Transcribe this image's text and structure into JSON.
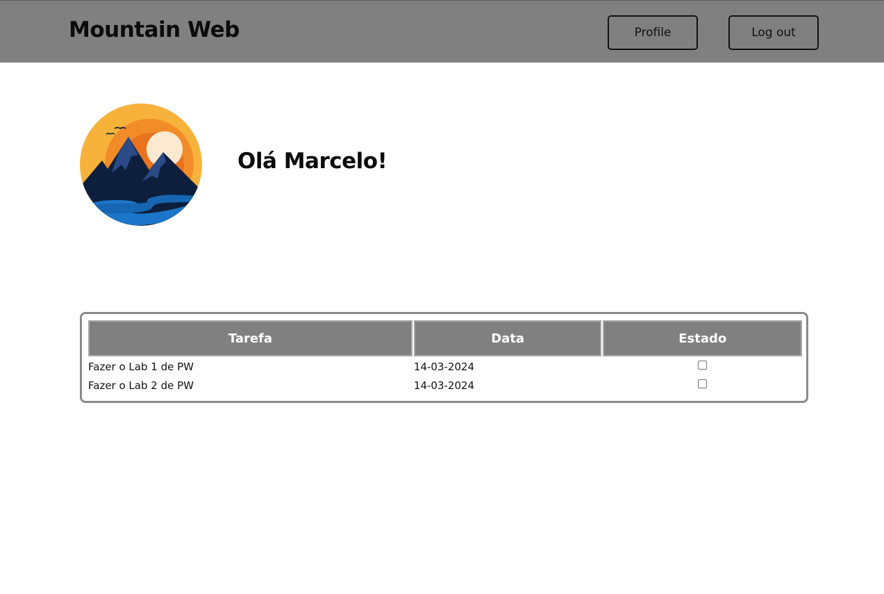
{
  "header": {
    "brand": "Mountain Web",
    "profile_label": "Profile",
    "logout_label": "Log out"
  },
  "main": {
    "greeting": "Olá Marcelo!"
  },
  "tasks": {
    "columns": [
      "Tarefa",
      "Data",
      "Estado"
    ],
    "rows": [
      {
        "task": "Fazer o Lab 1 de PW",
        "date": "14-03-2024",
        "done": false
      },
      {
        "task": "Fazer o Lab 2 de PW",
        "date": "14-03-2024",
        "done": false
      }
    ]
  },
  "colors": {
    "header_bg": "#808080",
    "table_header_bg": "#808080",
    "logo_sun_outer": "#f7b23b",
    "logo_sun_inner": "#f28c28",
    "logo_mountain": "#0d1f3c",
    "logo_river": "#1b75c9"
  }
}
